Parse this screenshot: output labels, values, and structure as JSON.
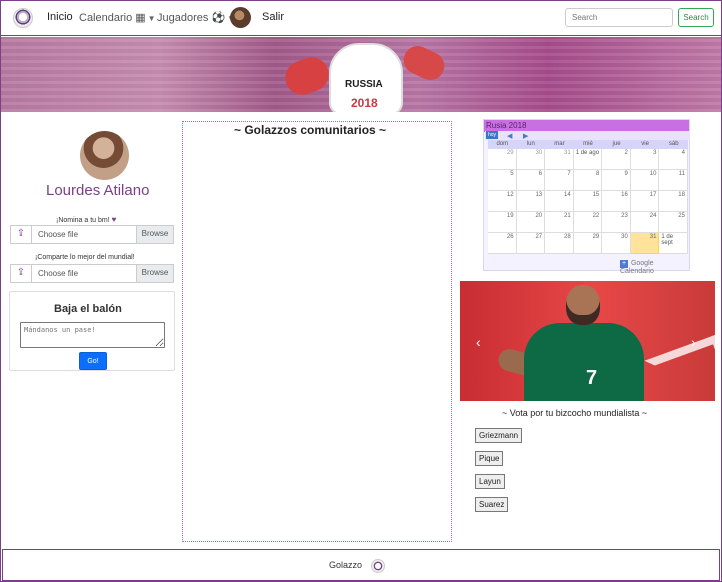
{
  "navbar": {
    "brand_icon": "soccer-ball-icon",
    "links": {
      "home": "Inicio",
      "calendar": "Calendario",
      "players": "Jugadores",
      "logout": "Salir"
    },
    "search_placeholder": "Search",
    "search_button": "Search"
  },
  "banner": {
    "mascot_text": "RUSSIA",
    "mascot_year": "2018"
  },
  "profile": {
    "name": "Lourdes Atilano"
  },
  "uploads": [
    {
      "label": "¡Nomina a tu bm!",
      "choose": "Choose file",
      "browse": "Browse"
    },
    {
      "label": "¡Comparte lo mejor del mundial!",
      "choose": "Choose file",
      "browse": "Browse"
    }
  ],
  "comment_card": {
    "title": "Baja el balón",
    "placeholder": "Mándanos un pase!",
    "button": "Go!"
  },
  "community": {
    "title": "~ Golazzos comunitarios ~"
  },
  "calendar": {
    "title": "Rusia 2018",
    "month_button": "hoy",
    "day_names": [
      "dom",
      "lun",
      "mar",
      "mié",
      "jue",
      "vie",
      "sáb"
    ],
    "weeks": [
      [
        "29",
        "30",
        "31",
        "1 de ago",
        "2",
        "3",
        "4"
      ],
      [
        "5",
        "6",
        "7",
        "8",
        "9",
        "10",
        "11"
      ],
      [
        "12",
        "13",
        "14",
        "15",
        "16",
        "17",
        "18"
      ],
      [
        "19",
        "20",
        "21",
        "22",
        "23",
        "24",
        "25"
      ],
      [
        "26",
        "27",
        "28",
        "29",
        "30",
        "31",
        "1 de sept"
      ]
    ],
    "footer_text": "Calendario",
    "google_text": "Google"
  },
  "player_vote": {
    "title": "~ Vota por tu bizcocho mundialista ~",
    "number": "7",
    "buttons": [
      "Griezmann",
      "Pique",
      "Layun",
      "Suarez"
    ]
  },
  "footer": {
    "text": "Golazzo"
  },
  "colors": {
    "primary": "#7b3f87",
    "success": "#32a852",
    "button_blue": "#0d6efd"
  }
}
